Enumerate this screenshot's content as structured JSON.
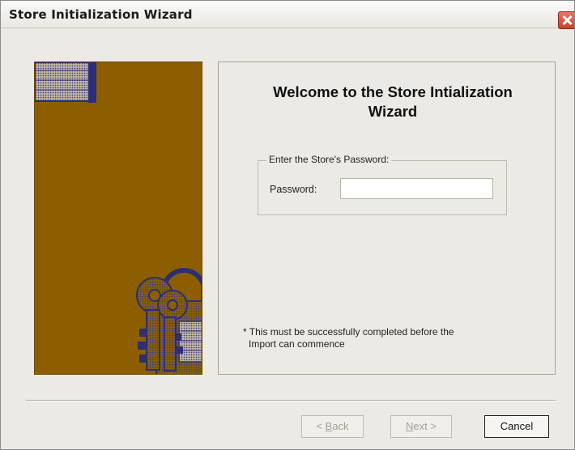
{
  "window": {
    "title": "Store Initialization Wizard"
  },
  "welcome": {
    "line1": "Welcome to the Store Intialization",
    "line2": "Wizard"
  },
  "group": {
    "legend": "Enter the Store's Password:"
  },
  "password": {
    "label": "Password:",
    "value": ""
  },
  "note": {
    "line1": "* This must be successfully completed before the",
    "line2": "Import can commence"
  },
  "buttons": {
    "back": {
      "prefix": "< ",
      "mnemonic": "B",
      "rest": "ack"
    },
    "next": {
      "mnemonic": "N",
      "rest": "ext >"
    },
    "cancel": "Cancel"
  },
  "colors": {
    "side_panel": "#8c5e00",
    "illustration": "#3b3f8c",
    "close_button": "#d55a45"
  },
  "icons": {
    "close": "close-icon",
    "illustration": "keys-and-lock-icon"
  }
}
